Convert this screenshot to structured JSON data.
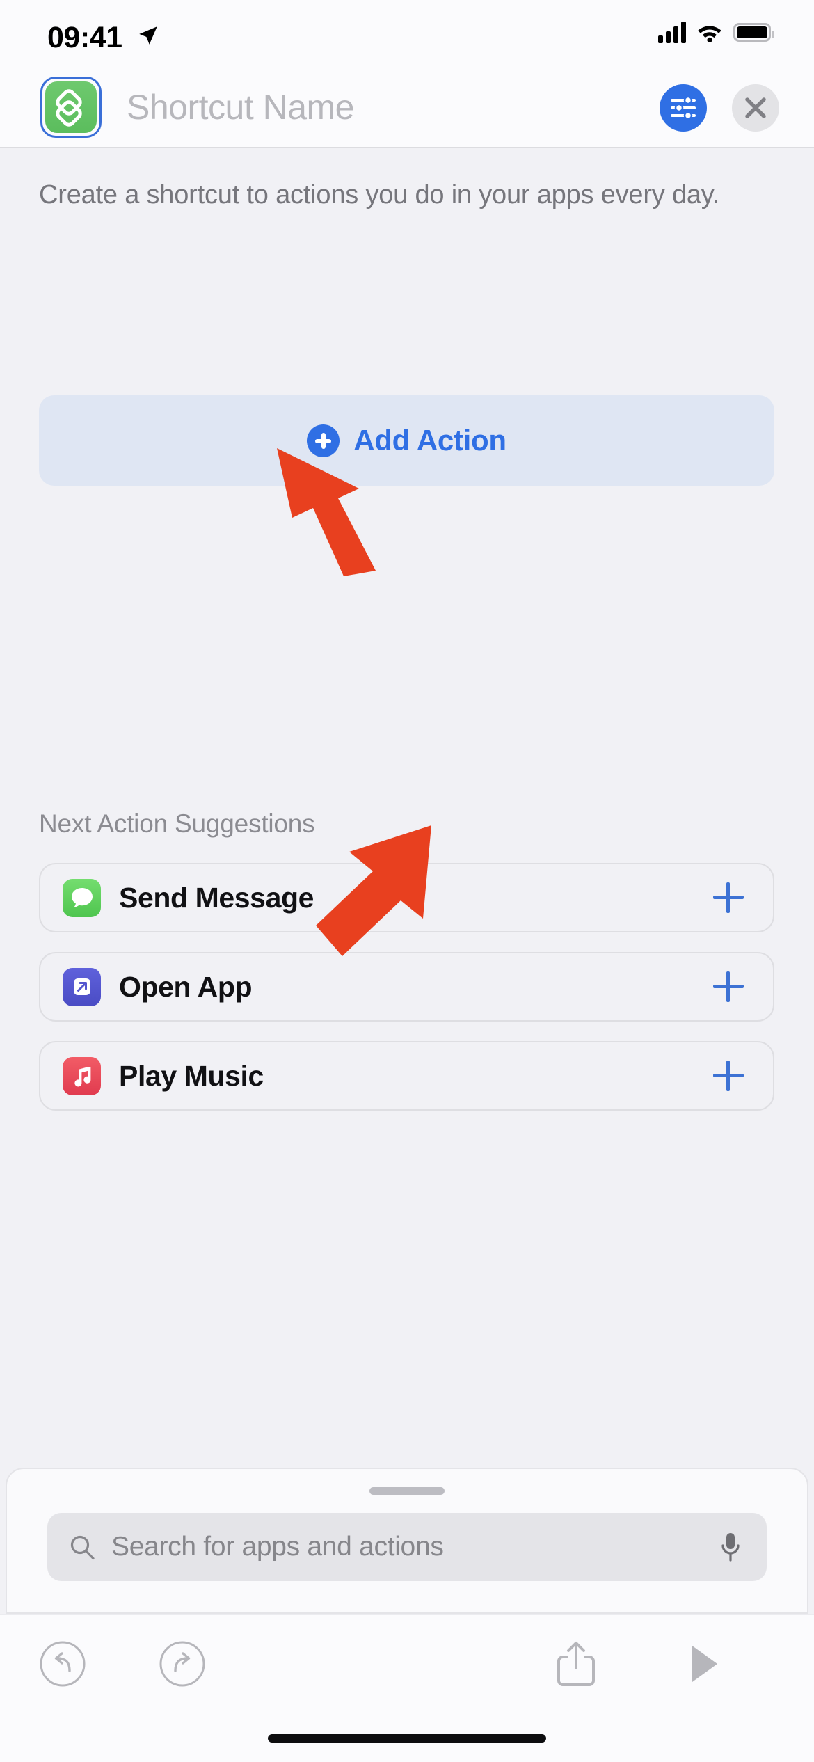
{
  "status_bar": {
    "time": "09:41",
    "location_icon": "location-arrow-icon",
    "cellular_icon": "cellular-bars-icon",
    "wifi_icon": "wifi-icon",
    "battery_icon": "battery-full-icon"
  },
  "header": {
    "shortcut_icon": "shortcuts-glyph-icon",
    "shortcut_icon_color": "#5bbd5d",
    "shortcut_icon_selected_ring_color": "#3a6fd8",
    "name_placeholder": "Shortcut Name",
    "settings_button": {
      "icon": "sliders-icon",
      "color": "#2f6fe4"
    },
    "close_button": {
      "icon": "close-x-icon",
      "color": "#e3e3e6"
    }
  },
  "main": {
    "description": "Create a shortcut to actions you do in your apps every day.",
    "add_action": {
      "label": "Add Action",
      "icon": "plus-circle-icon",
      "accent_color": "#2f6fe4",
      "background_color": "#dfe6f3"
    },
    "suggestions_header": "Next Action Suggestions",
    "suggestions": [
      {
        "label": "Send Message",
        "icon": "messages-app-icon",
        "icon_color": "#62ce64",
        "add_icon": "plus-icon"
      },
      {
        "label": "Open App",
        "icon": "open-app-icon",
        "icon_color": "#5456cf",
        "add_icon": "plus-icon"
      },
      {
        "label": "Play Music",
        "icon": "music-app-icon",
        "icon_color": "#e84c5b",
        "add_icon": "plus-icon"
      }
    ]
  },
  "search_sheet": {
    "grabber": "sheet-grabber-handle",
    "search_icon": "search-icon",
    "placeholder": "Search for apps and actions",
    "mic_icon": "microphone-icon"
  },
  "toolbar": {
    "undo": "undo-icon",
    "redo": "redo-icon",
    "share": "share-icon",
    "run": "play-icon",
    "icon_color": "#b6b6bb"
  },
  "annotations": {
    "arrow_color": "#e8401f",
    "arrows": [
      {
        "name": "arrow-pointing-to-add-action",
        "target": "Add Action"
      },
      {
        "name": "arrow-pointing-to-search-field",
        "target": "Search for apps and actions"
      }
    ]
  }
}
